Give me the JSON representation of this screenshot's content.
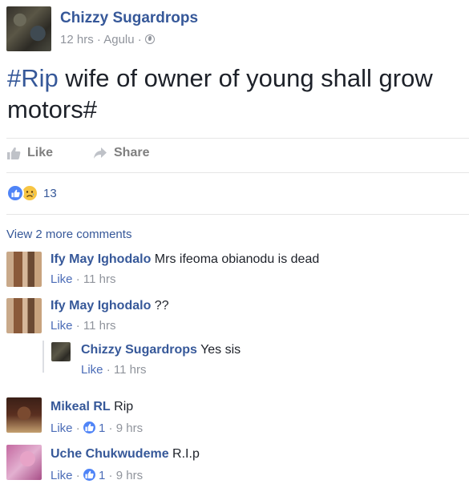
{
  "post": {
    "author": "Chizzy Sugardrops",
    "time": "12 hrs",
    "location": "Agulu",
    "separator": "·",
    "hashtag": "#Rip",
    "text": " wife of owner of young shall grow motors#"
  },
  "actions": {
    "like_label": "Like",
    "share_label": "Share"
  },
  "reactions": {
    "count": "13",
    "types": [
      "like",
      "sad"
    ]
  },
  "view_more": "View 2 more comments",
  "comments": [
    {
      "name": "Ify May Ighodalo",
      "text": "Mrs ifeoma obianodu is dead",
      "like_label": "Like",
      "time": "11 hrs"
    },
    {
      "name": "Ify May Ighodalo",
      "text": "??",
      "like_label": "Like",
      "time": "11 hrs"
    },
    {
      "name": "Chizzy Sugardrops",
      "text": "Yes sis",
      "like_label": "Like",
      "time": "11 hrs",
      "is_reply": true
    },
    {
      "name": "Mikeal RL",
      "text": "Rip",
      "like_label": "Like",
      "likes": "1",
      "time": "9 hrs"
    },
    {
      "name": "Uche Chukwudeme",
      "text": "R.I.p",
      "like_label": "Like",
      "likes": "1",
      "time": "9 hrs"
    }
  ],
  "colors": {
    "link": "#365899",
    "meta": "#90949c",
    "like_blue": "#4f84f7",
    "sad_yellow": "#f7c543"
  }
}
